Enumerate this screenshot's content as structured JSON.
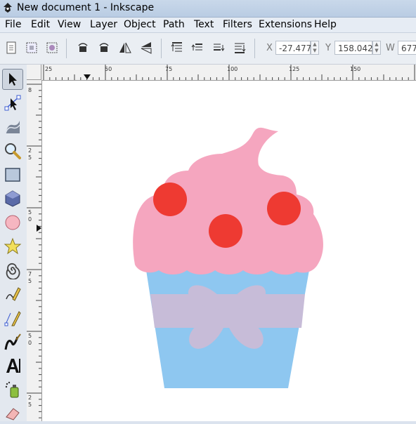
{
  "window": {
    "title": "New document 1 - Inkscape"
  },
  "menu": [
    "File",
    "Edit",
    "View",
    "Layer",
    "Object",
    "Path",
    "Text",
    "Filters",
    "Extensions",
    "Help"
  ],
  "toolbar": {
    "x_label": "X",
    "x_value": "-27.477",
    "y_label": "Y",
    "y_value": "158.042",
    "w_label": "W",
    "w_value": "677"
  },
  "ruler": {
    "horizontal": [
      "25",
      "50",
      "75",
      "100",
      "125",
      "150"
    ],
    "vertical": [
      "8",
      "2",
      "5",
      "5",
      "0",
      "7",
      "5",
      "5",
      "0",
      "2",
      "5"
    ]
  },
  "tools": [
    "selector-tool",
    "node-tool",
    "tweak-tool",
    "zoom-tool",
    "rectangle-tool",
    "3d-box-tool",
    "ellipse-tool",
    "star-tool",
    "spiral-tool",
    "pencil-tool",
    "pen-tool",
    "calligraphy-tool",
    "text-tool",
    "spray-tool",
    "eraser-tool"
  ],
  "colors": {
    "frosting": "#f5a6bf",
    "cherry": "#ee3a32",
    "cup": "#8ec7f0",
    "ribbon": "#c7bcd8"
  }
}
